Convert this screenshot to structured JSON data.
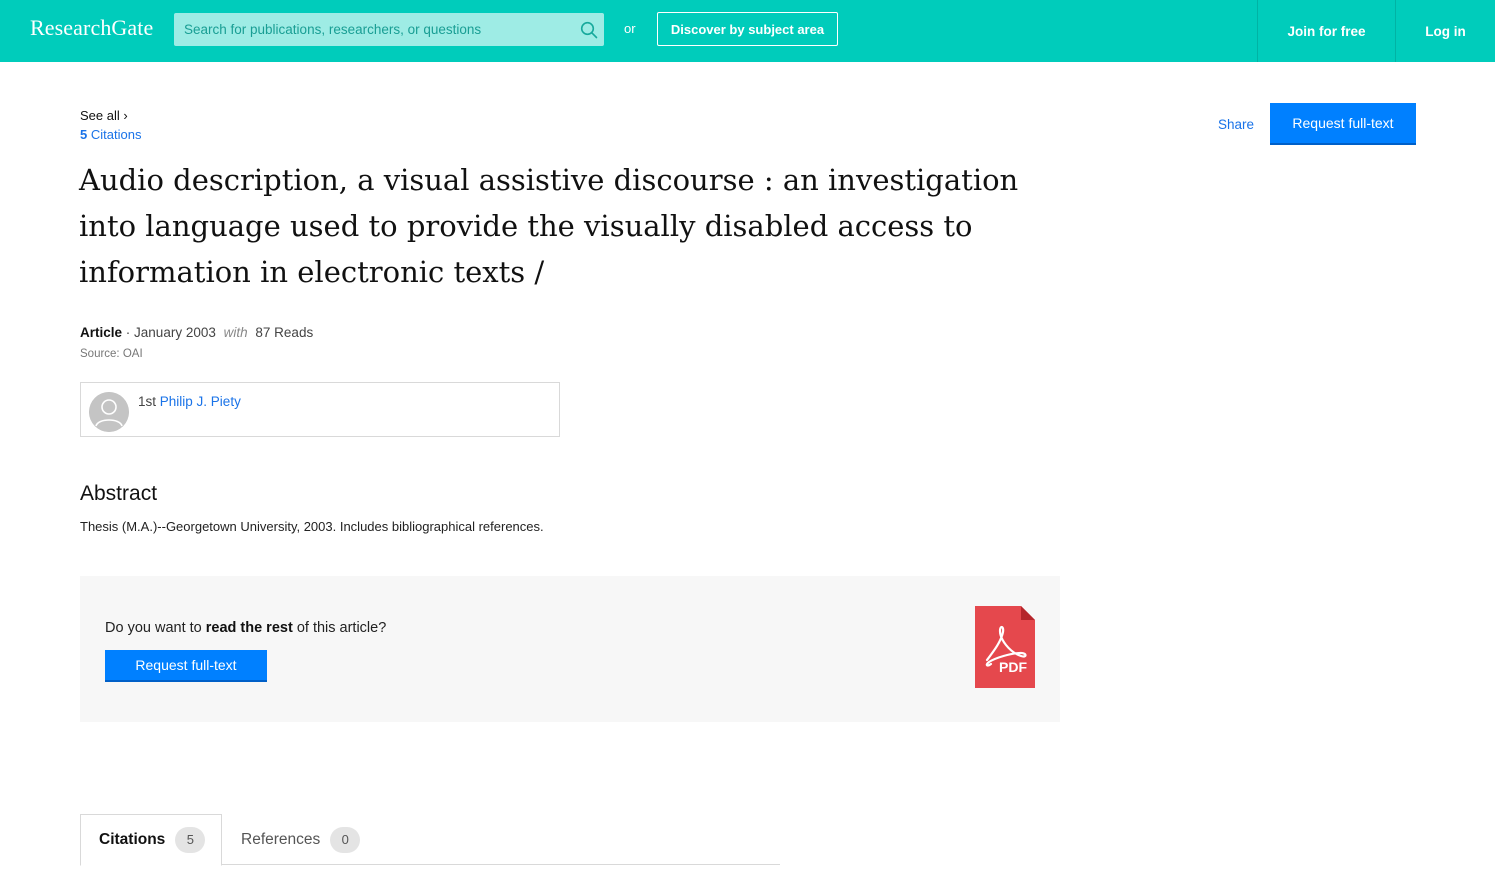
{
  "header": {
    "logo": "ResearchGate",
    "search_placeholder": "Search for publications, researchers, or questions",
    "or_label": "or",
    "discover_label": "Discover by subject area",
    "join_label": "Join for free",
    "login_label": "Log in",
    "colors": {
      "brand": "#00ccbb"
    }
  },
  "citations_top": {
    "see_all": "See all ›",
    "count": "5",
    "label": "Citations"
  },
  "actions": {
    "share_label": "Share",
    "request_label": "Request full-text",
    "accent": "#0080ff"
  },
  "publication": {
    "title": "Audio description, a visual assistive discourse : an investigation into language used to provide the visually disabled access to information in electronic texts /",
    "type": "Article",
    "date": "· January 2003",
    "with": "with",
    "reads": "87 Reads",
    "source": "Source: OAI"
  },
  "author": {
    "position": "1st",
    "name": "Philip J. Piety"
  },
  "abstract": {
    "heading": "Abstract",
    "text": "Thesis (M.A.)--Georgetown University, 2003. Includes bibliographical references."
  },
  "read_rest": {
    "prefix": "Do you want to ",
    "bold": "read the rest",
    "suffix": " of this article?",
    "button_label": "Request full-text",
    "pdf_label": "PDF",
    "pdf_color": "#e5484d"
  },
  "tabs": [
    {
      "label": "Citations",
      "count": "5",
      "active": true
    },
    {
      "label": "References",
      "count": "0",
      "active": false
    }
  ]
}
